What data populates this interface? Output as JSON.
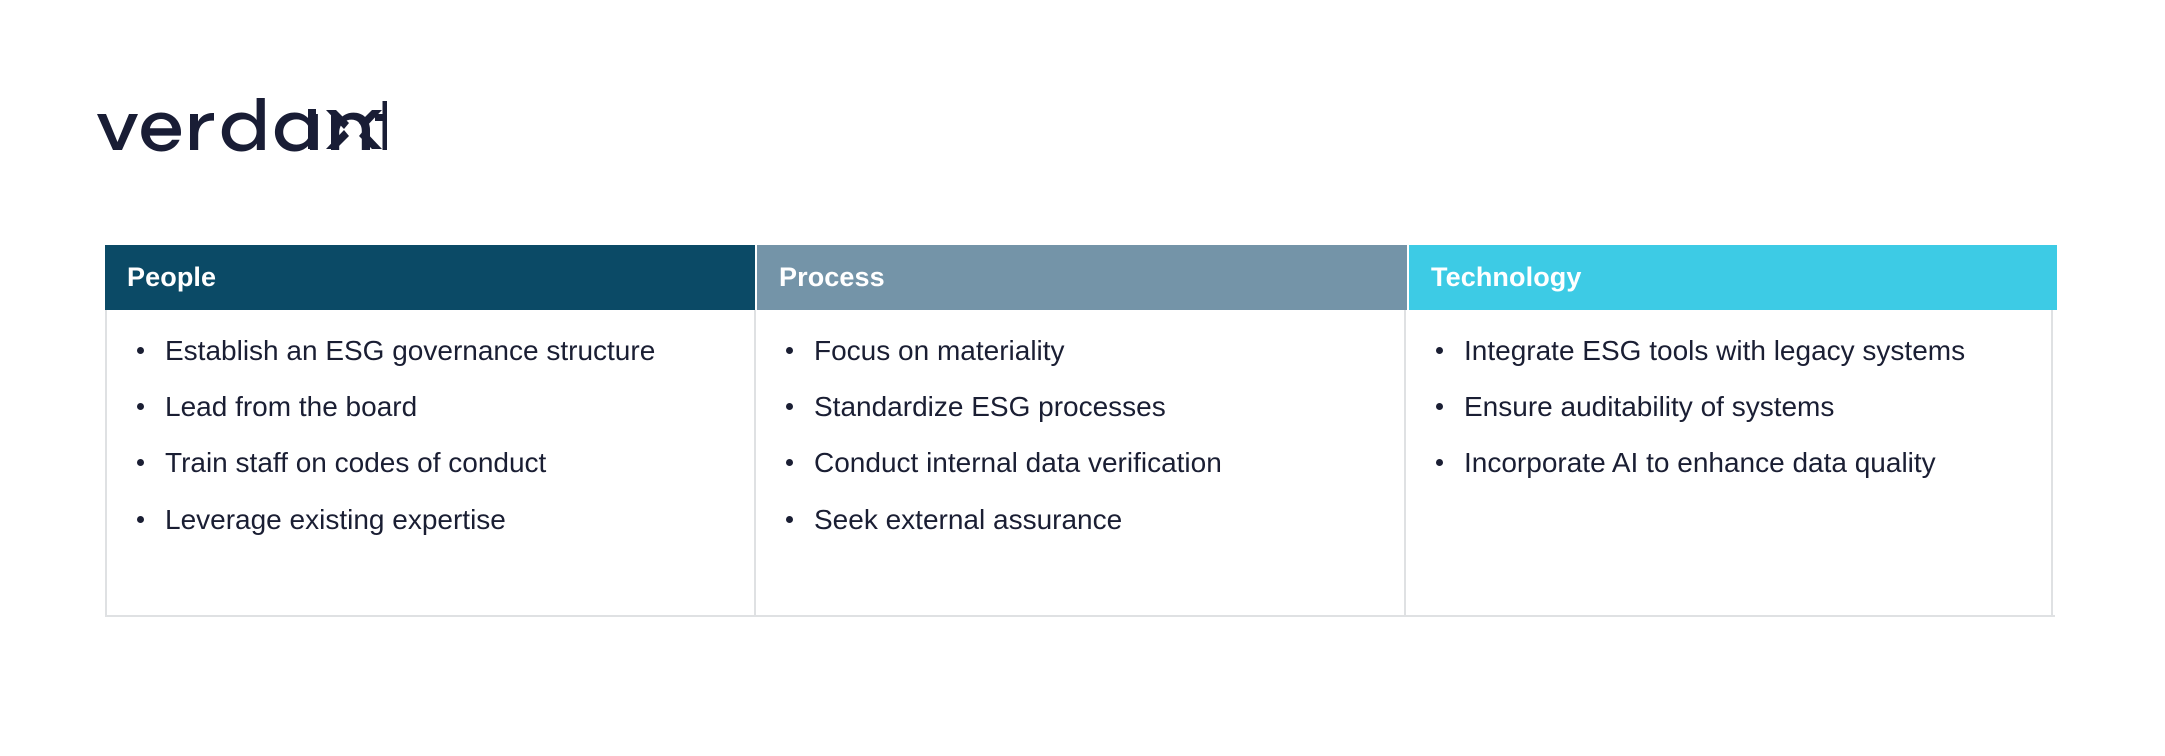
{
  "brand": {
    "logo_text": "verdantix",
    "logo_color": "#191D35",
    "logo_icon": "verdantix-four-point-star-x"
  },
  "colors": {
    "people_header_bg": "#0B4A66",
    "process_header_bg": "#7494A8",
    "technology_header_bg": "#3DCBE5",
    "header_text": "#FFFFFF",
    "body_text": "#1A1E33",
    "border": "#DFE1E3",
    "page_bg": "#FFFFFF"
  },
  "table": {
    "columns": [
      {
        "header": "People",
        "items": [
          "Establish an ESG governance structure",
          "Lead from the board",
          "Train staff on codes of conduct",
          "Leverage existing expertise"
        ]
      },
      {
        "header": "Process",
        "items": [
          "Focus on materiality",
          "Standardize ESG processes",
          "Conduct internal data verification",
          "Seek external assurance"
        ]
      },
      {
        "header": "Technology",
        "items": [
          "Integrate ESG tools with legacy systems",
          "Ensure auditability of systems",
          "Incorporate AI to enhance data quality"
        ]
      }
    ]
  }
}
